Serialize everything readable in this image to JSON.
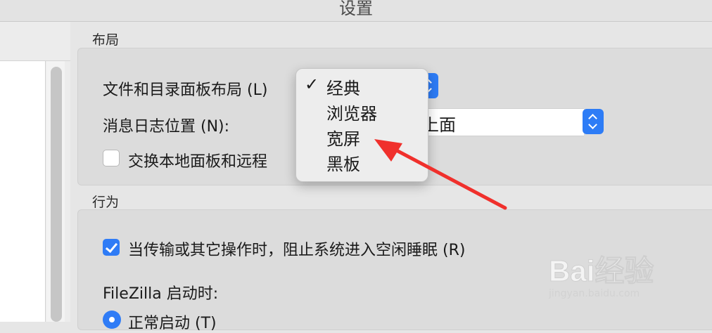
{
  "window": {
    "title": "设置"
  },
  "layout_section": {
    "label": "布局",
    "file_dir_layout_label": "文件和目录面板布局 (L)",
    "message_log_label": "消息日志位置 (N):",
    "message_log_value": "上面",
    "swap_label": "交换本地面板和远程",
    "swap_checked": false
  },
  "layout_menu": {
    "items": [
      {
        "label": "经典",
        "checked": true
      },
      {
        "label": "浏览器",
        "checked": false
      },
      {
        "label": "宽屏",
        "checked": false
      },
      {
        "label": "黑板",
        "checked": false
      }
    ],
    "check_glyph": "✓"
  },
  "behavior_section": {
    "label": "行为",
    "prevent_sleep_label": "当传输或其它操作时，阻止系统进入空闲睡眠 (R)",
    "prevent_sleep_checked": true,
    "startup_label": "FileZilla 启动时:",
    "startup_option_normal": "正常启动 (T)"
  },
  "watermark": {
    "logo_text": "Bai经验",
    "url": "jingyan.baidu.com"
  },
  "colors": {
    "accent": "#2f7cf6",
    "annotation_arrow": "#f0302c"
  }
}
